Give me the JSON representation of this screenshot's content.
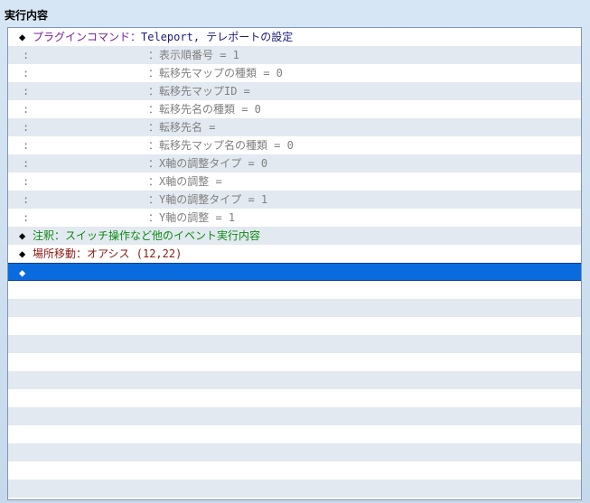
{
  "panel": {
    "title": "実行内容"
  },
  "commands": {
    "plugin": {
      "marker": "◆",
      "head": "プラグインコマンド：",
      "value": "Teleport, テレポートの設定",
      "params": [
        {
          "marker": ":",
          "text": "：表示順番号 = 1"
        },
        {
          "marker": ":",
          "text": "：転移先マップの種類 = 0"
        },
        {
          "marker": ":",
          "text": "：転移先マップID ="
        },
        {
          "marker": ":",
          "text": "：転移先名の種類 = 0"
        },
        {
          "marker": ":",
          "text": "：転移先名 ="
        },
        {
          "marker": ":",
          "text": "：転移先マップ名の種類 = 0"
        },
        {
          "marker": ":",
          "text": "：X軸の調整タイプ = 0"
        },
        {
          "marker": ":",
          "text": "：X軸の調整 ="
        },
        {
          "marker": ":",
          "text": "：Y軸の調整タイプ = 1"
        },
        {
          "marker": ":",
          "text": "：Y軸の調整 = 1"
        }
      ]
    },
    "comment": {
      "marker": "◆",
      "text": "注釈：スイッチ操作など他のイベント実行内容"
    },
    "transfer": {
      "marker": "◆",
      "text": "場所移動：オアシス (12,22)"
    },
    "empty": {
      "marker": "◆"
    }
  },
  "colors": {
    "selection": "#0a6bde",
    "plugin": "#7a1fa2",
    "comment": "#0d8a12",
    "transfer": "#8a1a12",
    "param": "#808080"
  }
}
